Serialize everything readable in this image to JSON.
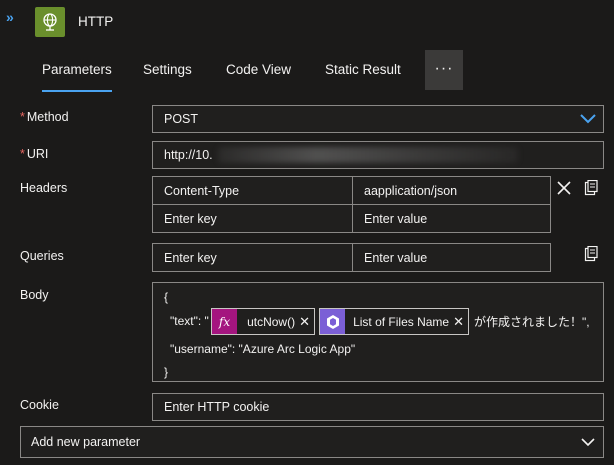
{
  "header": {
    "title": "HTTP",
    "collapse_glyph": "»",
    "icon": "http-globe-icon"
  },
  "tabs": [
    {
      "label": "Parameters",
      "active": true
    },
    {
      "label": "Settings",
      "active": false
    },
    {
      "label": "Code View",
      "active": false
    },
    {
      "label": "Static Result",
      "active": false
    }
  ],
  "more_label": "···",
  "method": {
    "label": "Method",
    "required_mark": "*",
    "value": "POST"
  },
  "uri": {
    "label": "URI",
    "required_mark": "*",
    "value": "http://10."
  },
  "headers": {
    "label": "Headers",
    "rows": [
      {
        "key": "Content-Type",
        "value": "aapplication/json"
      },
      {
        "key": "Enter key",
        "value": "Enter value"
      }
    ]
  },
  "queries": {
    "label": "Queries",
    "key_placeholder": "Enter key",
    "value_placeholder": "Enter value"
  },
  "body": {
    "label": "Body",
    "open_brace": "{",
    "text_prefix": "\"text\": \"",
    "token_func": "utcNow()",
    "token_func_glyph": "fx",
    "token_list": "List of Files Name",
    "text_suffix": "が作成されました！\",",
    "username_line": "\"username\": \"Azure Arc Logic App\"",
    "close_brace": "}"
  },
  "cookie": {
    "label": "Cookie",
    "placeholder": "Enter HTTP cookie"
  },
  "add_parameter": {
    "label": "Add new parameter"
  },
  "colors": {
    "accent": "#4aa3f0",
    "app_icon": "#6a8f2c",
    "func_token": "#a4157f",
    "list_token": "#7b5fd6",
    "required": "#e86863"
  }
}
